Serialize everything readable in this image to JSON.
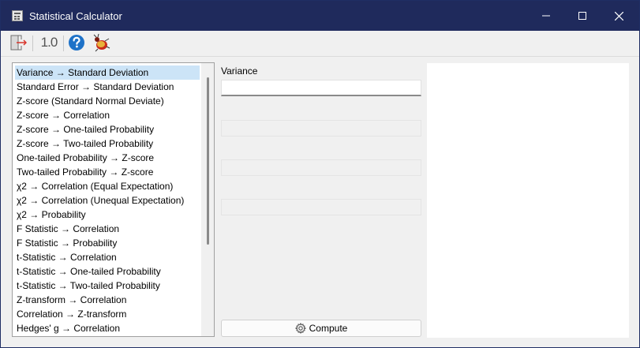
{
  "window": {
    "title": "Statistical Calculator",
    "icon": "calculator-icon",
    "controls": [
      "minimize-icon",
      "maximize-icon",
      "close-icon"
    ]
  },
  "toolbar": {
    "items": [
      {
        "icon": "exit-icon"
      },
      {
        "label": "1.0"
      },
      {
        "icon": "help-icon"
      },
      {
        "icon": "bug-report-icon"
      }
    ]
  },
  "conversions": {
    "selected_index": 0,
    "items": [
      "Variance → Standard Deviation",
      "Standard Error → Standard Deviation",
      "Z-score (Standard Normal Deviate)",
      "Z-score → Correlation",
      "Z-score → One-tailed Probability",
      "Z-score → Two-tailed Probability",
      "One-tailed Probability → Z-score",
      "Two-tailed Probability → Z-score",
      "χ2 → Correlation (Equal Expectation)",
      "χ2 → Correlation (Unequal Expectation)",
      "χ2 → Probability",
      "F Statistic → Correlation",
      "F Statistic → Probability",
      "t-Statistic → Correlation",
      "t-Statistic → One-tailed Probability",
      "t-Statistic → Two-tailed Probability",
      "Z-transform → Correlation",
      "Correlation → Z-transform",
      "Hedges' g → Correlation"
    ]
  },
  "inputs": {
    "field1": {
      "label": "Variance",
      "value": ""
    },
    "field2": {
      "value": ""
    },
    "field3": {
      "value": ""
    },
    "field4": {
      "value": ""
    }
  },
  "compute": {
    "label": "Compute",
    "icon": "gear-icon"
  },
  "output": {
    "text": ""
  },
  "colors": {
    "titlebar": "#1f2a5c",
    "selection": "#cce4f7",
    "help": "#1e72c8"
  }
}
